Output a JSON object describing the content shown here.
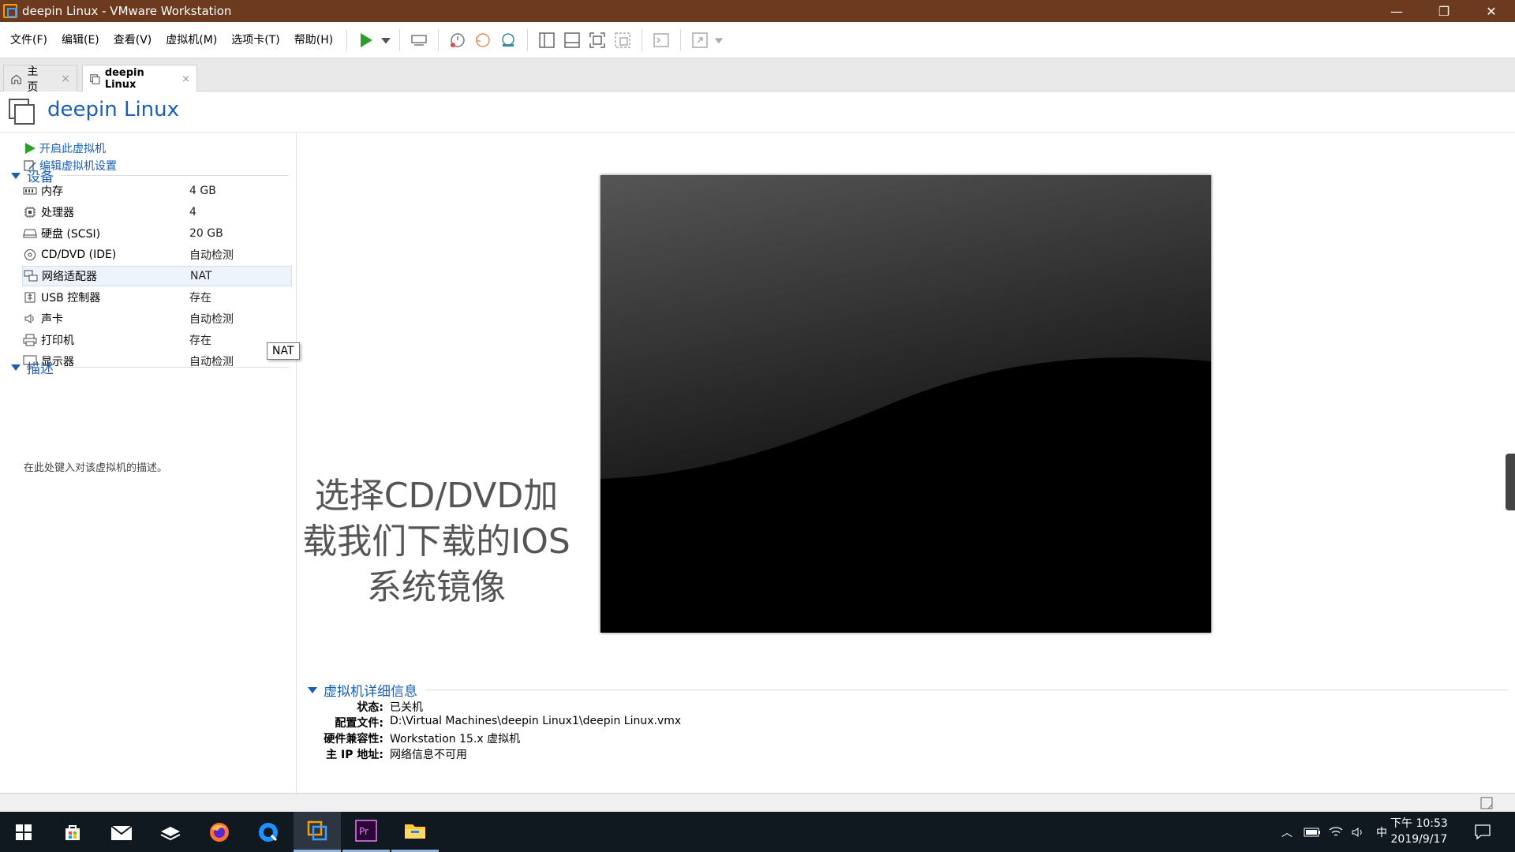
{
  "window": {
    "title": "deepin Linux - VMware Workstation",
    "controls": {
      "minimize": "—",
      "restore": "❐",
      "close": "✕"
    }
  },
  "menu": [
    "文件(F)",
    "编辑(E)",
    "查看(V)",
    "虚拟机(M)",
    "选项卡(T)",
    "帮助(H)"
  ],
  "tabs": [
    {
      "label": "主页",
      "close": "×"
    },
    {
      "label": "deepin Linux",
      "close": "×"
    }
  ],
  "vm": {
    "name": "deepin Linux",
    "actions": {
      "power_on": "开启此虚拟机",
      "edit_settings": "编辑虚拟机设置"
    },
    "devices_header": "设备",
    "devices": [
      {
        "name": "内存",
        "value": "4 GB",
        "icon": "memory-icon"
      },
      {
        "name": "处理器",
        "value": "4",
        "icon": "cpu-icon"
      },
      {
        "name": "硬盘 (SCSI)",
        "value": "20 GB",
        "icon": "harddisk-icon"
      },
      {
        "name": "CD/DVD (IDE)",
        "value": "自动检测",
        "icon": "cd-icon"
      },
      {
        "name": "网络适配器",
        "value": "NAT",
        "icon": "network-icon"
      },
      {
        "name": "USB 控制器",
        "value": "存在",
        "icon": "usb-icon"
      },
      {
        "name": "声卡",
        "value": "自动检测",
        "icon": "sound-icon"
      },
      {
        "name": "打印机",
        "value": "存在",
        "icon": "printer-icon"
      },
      {
        "name": "显示器",
        "value": "自动检测",
        "icon": "display-icon"
      }
    ],
    "tooltip": "NAT",
    "description_header": "描述",
    "description_placeholder": "在此处键入对该虚拟机的描述。",
    "overlay_lines": [
      "选择CD/DVD加",
      "载我们下载的IOS",
      "系统镜像"
    ],
    "details_header": "虚拟机详细信息",
    "details": [
      {
        "key": "状态:",
        "value": "已关机"
      },
      {
        "key": "配置文件:",
        "value": "D:\\Virtual Machines\\deepin Linux1\\deepin Linux.vmx"
      },
      {
        "key": "硬件兼容性:",
        "value": "Workstation 15.x 虚拟机"
      },
      {
        "key": "主 IP 地址:",
        "value": "网络信息不可用"
      }
    ]
  },
  "taskbar": {
    "ime": "中",
    "clock_time": "下午 10:53",
    "clock_date": "2019/9/17"
  },
  "colors": {
    "titlebar": "#6b3a1f",
    "accent": "#1a5fb4",
    "taskbar": "#101820"
  }
}
